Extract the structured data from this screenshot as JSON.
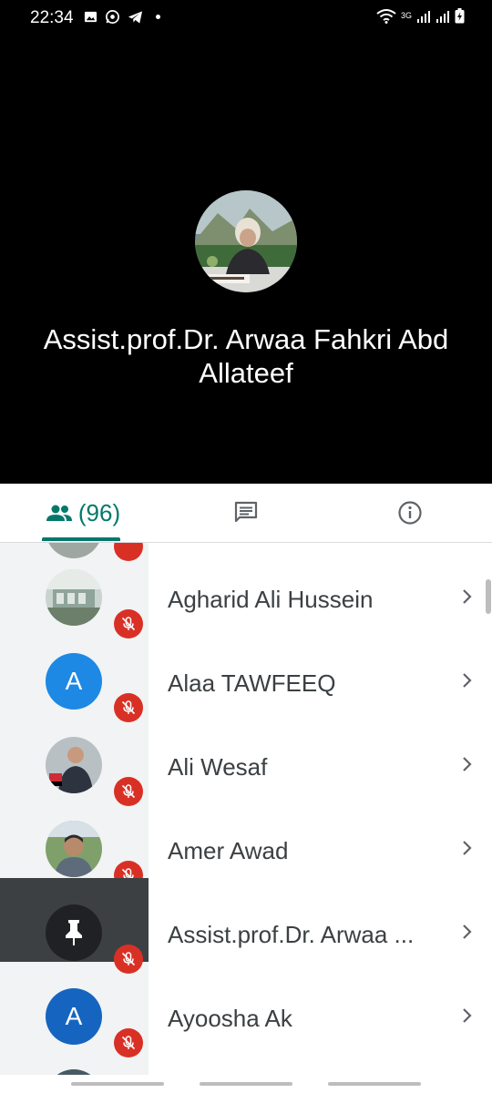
{
  "status_bar": {
    "time": "22:34",
    "network": "3G"
  },
  "speaker": {
    "name": "Assist.prof.Dr. Arwaa Fahkri Abd Allateef"
  },
  "tabs": {
    "people_count": "(96)"
  },
  "participants": [
    {
      "name": "Agharid Ali Hussein",
      "avatar_type": "photo",
      "muted": true
    },
    {
      "name": "Alaa TAWFEEQ",
      "avatar_type": "letter",
      "letter": "A",
      "avatar_color": "#1e88e5",
      "muted": true
    },
    {
      "name": "Ali Wesaf",
      "avatar_type": "photo",
      "muted": true
    },
    {
      "name": "Amer Awad",
      "avatar_type": "photo",
      "muted": true
    },
    {
      "name": "Assist.prof.Dr. Arwaa ...",
      "avatar_type": "pin",
      "muted": true,
      "active": true
    },
    {
      "name": "Ayoosha Ak",
      "avatar_type": "letter",
      "letter": "A",
      "avatar_color": "#1565c0",
      "muted": true
    }
  ],
  "colors": {
    "accent": "#00796b",
    "mic_off": "#d93025"
  }
}
